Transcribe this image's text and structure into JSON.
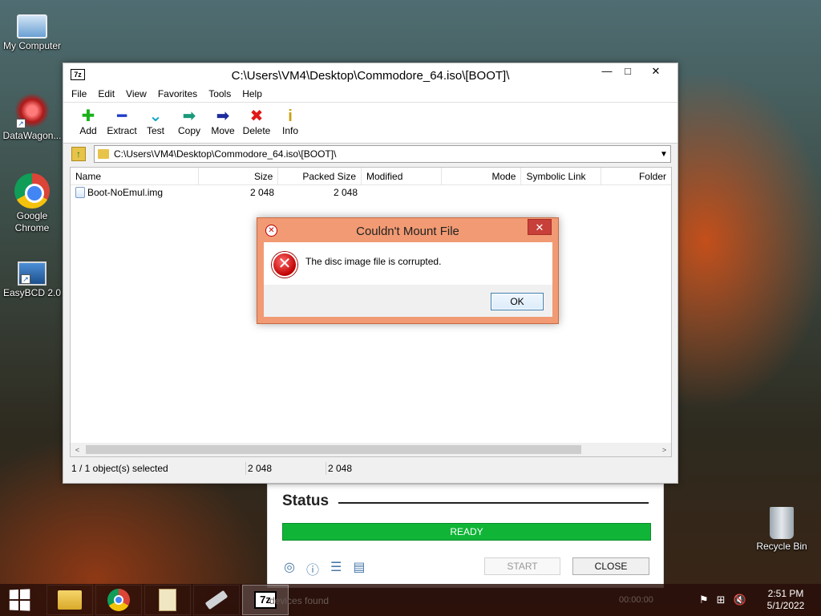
{
  "desktop": {
    "icons": [
      {
        "label": "My Computer"
      },
      {
        "label": "DataWagon..."
      },
      {
        "label": "Google Chrome"
      },
      {
        "label": "EasyBCD 2.0"
      },
      {
        "label": "Recycle Bin"
      }
    ]
  },
  "sevenzip": {
    "app_icon": "7z",
    "title": "C:\\Users\\VM4\\Desktop\\Commodore_64.iso\\[BOOT]\\",
    "controls": {
      "minimize": "—",
      "maximize": "□",
      "close": "✕"
    },
    "menu": [
      "File",
      "Edit",
      "View",
      "Favorites",
      "Tools",
      "Help"
    ],
    "toolbar": [
      {
        "label": "Add",
        "icon": "plus-icon",
        "glyph": "✚"
      },
      {
        "label": "Extract",
        "icon": "minus-icon",
        "glyph": "━"
      },
      {
        "label": "Test",
        "icon": "check-chevron-icon",
        "glyph": "⌄"
      },
      {
        "label": "Copy",
        "icon": "copy-arrow-icon",
        "glyph": "➡"
      },
      {
        "label": "Move",
        "icon": "move-arrow-icon",
        "glyph": "➡"
      },
      {
        "label": "Delete",
        "icon": "delete-x-icon",
        "glyph": "✖"
      },
      {
        "label": "Info",
        "icon": "info-icon",
        "glyph": "i"
      }
    ],
    "address": "C:\\Users\\VM4\\Desktop\\Commodore_64.iso\\[BOOT]\\",
    "columns": [
      "Name",
      "Size",
      "Packed Size",
      "Modified",
      "Mode",
      "Symbolic Link",
      "Folder"
    ],
    "rows": [
      {
        "name": "Boot-NoEmul.img",
        "size": "2 048",
        "packed": "2 048"
      }
    ],
    "status": {
      "selected": "1 / 1 object(s) selected",
      "size": "2 048",
      "packed": "2 048"
    },
    "scroll": {
      "left": "<",
      "right": ">"
    }
  },
  "dialog": {
    "title": "Couldn't Mount File",
    "message": "The disc image file is corrupted.",
    "ok_label": "OK",
    "close": "✕",
    "error_glyph": "✕"
  },
  "status_panel": {
    "heading": "Status",
    "bar_text": "READY",
    "bar_color": "#10b537",
    "start_label": "START",
    "close_label": "CLOSE",
    "icons": [
      "globe-icon",
      "info-icon",
      "settings-sliders-icon",
      "log-list-icon"
    ]
  },
  "taskbar": {
    "underlying_text": "devices found",
    "timer_text": "00:00:00",
    "clock_time": "2:51 PM",
    "clock_date": "5/1/2022"
  }
}
